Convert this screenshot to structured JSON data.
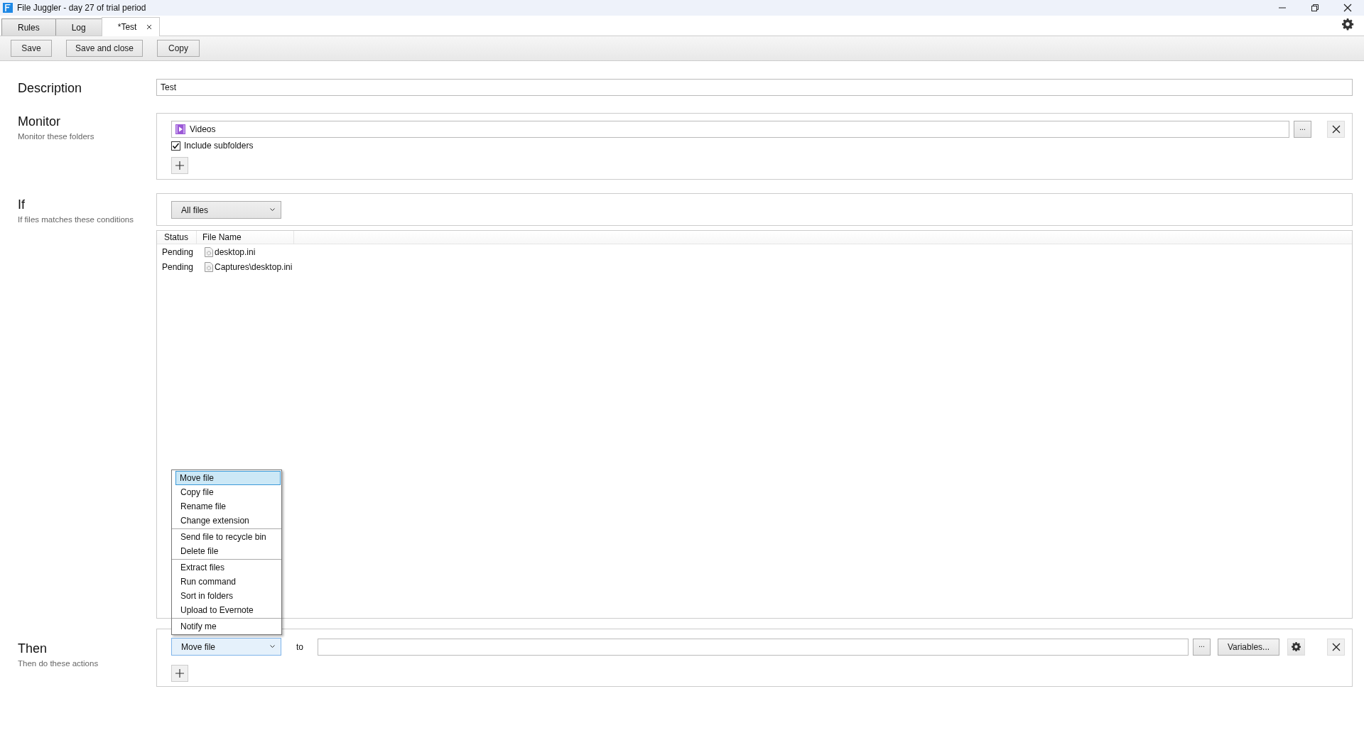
{
  "window": {
    "title": "File Juggler - day 27 of trial period"
  },
  "tabs": [
    {
      "label": "Rules",
      "selected": false,
      "closable": false
    },
    {
      "label": "Log",
      "selected": false,
      "closable": false
    },
    {
      "label": "*Test",
      "selected": true,
      "closable": true
    }
  ],
  "toolbar": {
    "buttons": [
      "Save",
      "Save and close",
      "Copy"
    ]
  },
  "description": {
    "label": "Description",
    "value": "Test"
  },
  "monitor": {
    "label": "Monitor",
    "hint": "Monitor these folders",
    "folders": [
      {
        "name": "Videos",
        "browse": "...",
        "include_subfolders_label": "Include subfolders",
        "include_subfolders": true
      }
    ]
  },
  "condition": {
    "label": "If",
    "hint": "If files matches these conditions",
    "value": "All files"
  },
  "files": {
    "columns": [
      "Status",
      "File Name"
    ],
    "rows": [
      {
        "status": "Pending",
        "name": "desktop.ini"
      },
      {
        "status": "Pending",
        "name": "Captures\\desktop.ini"
      }
    ]
  },
  "then": {
    "label": "Then",
    "hint": "Then do these actions",
    "actions": [
      {
        "action": "Move file",
        "to_label": "to",
        "browse": "...",
        "variables": "Variables..."
      }
    ]
  },
  "action_menu": {
    "groups": [
      [
        {
          "label": "Move file",
          "selected": true
        },
        {
          "label": "Copy file",
          "selected": false
        },
        {
          "label": "Rename file",
          "selected": false
        },
        {
          "label": "Change extension",
          "selected": false
        }
      ],
      [
        {
          "label": "Send file to recycle bin",
          "selected": false
        },
        {
          "label": "Delete file",
          "selected": false
        }
      ],
      [
        {
          "label": "Extract files",
          "selected": false
        },
        {
          "label": "Run command",
          "selected": false
        },
        {
          "label": "Sort in folders",
          "selected": false
        },
        {
          "label": "Upload to Evernote",
          "selected": false
        }
      ],
      [
        {
          "label": "Notify me",
          "selected": false
        }
      ]
    ]
  }
}
